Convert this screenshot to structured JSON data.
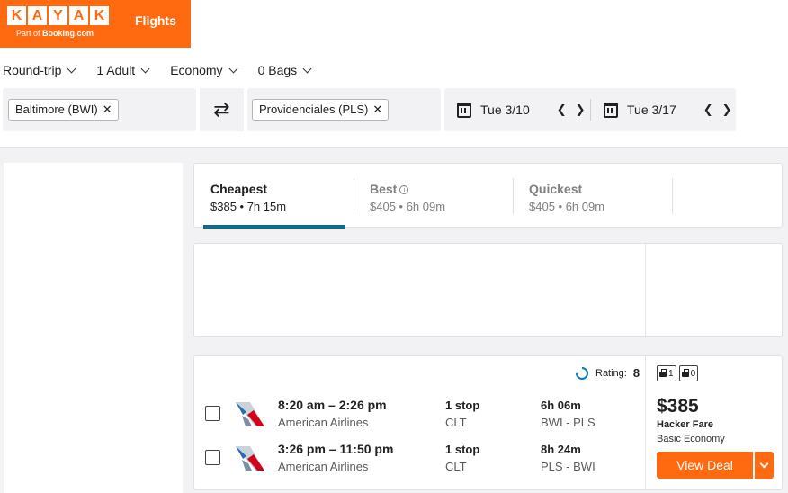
{
  "brand": {
    "letters": [
      "K",
      "A",
      "Y",
      "A",
      "K"
    ],
    "sub_prefix": "Part of ",
    "sub_brand": "Booking.com",
    "tab": "Flights",
    "color": "#ff690f"
  },
  "options": {
    "trip": "Round-trip",
    "travelers": "1 Adult",
    "cabin": "Economy",
    "bags": "0 Bags"
  },
  "search": {
    "origin": "Baltimore (BWI)",
    "destination": "Providenciales (PLS)",
    "depart": "Tue 3/10",
    "return": "Tue 3/17",
    "swap_icon": "swap-arrows-icon"
  },
  "sort": [
    {
      "label": "Cheapest",
      "detail": "$385 • 7h 15m",
      "active": true
    },
    {
      "label": "Best",
      "detail": "$405 • 6h 09m",
      "active": false
    },
    {
      "label": "Quickest",
      "detail": "$405 • 6h 09m",
      "active": false
    }
  ],
  "result": {
    "rating_label": "Rating:",
    "rating_value": "8",
    "legs": [
      {
        "times": "8:20 am – 2:26 pm",
        "airline": "American Airlines",
        "stops": "1 stop",
        "via": "CLT",
        "duration": "6h 06m",
        "route": "BWI - PLS"
      },
      {
        "times": "3:26 pm – 11:50 pm",
        "airline": "American Airlines",
        "stops": "1 stop",
        "via": "CLT",
        "duration": "8h 24m",
        "route": "PLS - BWI"
      }
    ],
    "carry_on": "1",
    "checked": "0",
    "price": "$385",
    "fare": "Hacker Fare",
    "cabin": "Basic Economy",
    "cta": "View Deal"
  },
  "colors": {
    "accent": "#ff690f",
    "sort_active": "#0a6f82"
  }
}
